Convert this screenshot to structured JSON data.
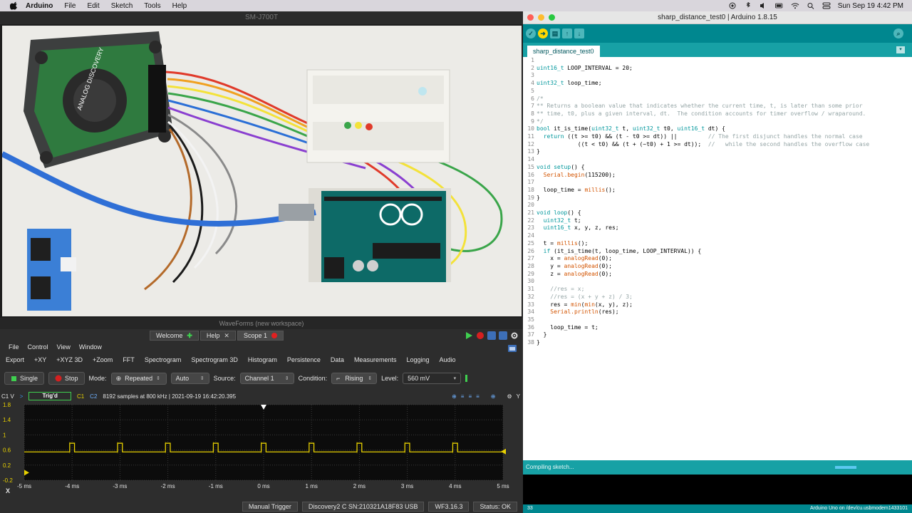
{
  "menubar": {
    "app_name": "Arduino",
    "items": [
      "File",
      "Edit",
      "Sketch",
      "Tools",
      "Help"
    ],
    "clock": "Sun Sep 19  4:42 PM"
  },
  "camera": {
    "title": "SM-J700T"
  },
  "waveforms": {
    "title": "WaveForms (new workspace)",
    "tabs": [
      "Welcome",
      "Help",
      "Scope 1"
    ],
    "menu": [
      "File",
      "Control",
      "View",
      "Window"
    ],
    "toolbar": [
      "Export",
      "+XY",
      "+XYZ 3D",
      "+Zoom",
      "FFT",
      "Spectrogram",
      "Spectrogram 3D",
      "Histogram",
      "Persistence",
      "Data",
      "Measurements",
      "Logging",
      "Audio"
    ],
    "controls": {
      "single": "Single",
      "stop": "Stop",
      "mode_label": "Mode:",
      "mode_value": "Repeated",
      "auto_value": "Auto",
      "source_label": "Source:",
      "source_value": "Channel 1",
      "condition_label": "Condition:",
      "condition_value": "Rising",
      "level_label": "Level:",
      "level_value": "560 mV"
    },
    "info": {
      "channel_unit": "C1 V",
      "trig_status": "Trig'd",
      "c1": "C1",
      "c2": "C2",
      "samples": "8192 samples at 800 kHz | 2021-09-19 16:42:20.395",
      "y": "Y"
    },
    "x_label": "X",
    "status": {
      "manual_trigger": "Manual Trigger",
      "device": "Discovery2 C SN:210321A18F83 USB",
      "version": "WF3.16.3",
      "status": "Status: OK"
    }
  },
  "chart_data": {
    "type": "line",
    "title": "",
    "xlabel": "",
    "ylabel": "C1 V",
    "xlim": [
      -5,
      5
    ],
    "ylim": [
      -0.2,
      1.8
    ],
    "x_ticks": [
      "-5 ms",
      "-4 ms",
      "-3 ms",
      "-2 ms",
      "-1 ms",
      "0 ms",
      "1 ms",
      "2 ms",
      "3 ms",
      "4 ms",
      "5 ms"
    ],
    "y_ticks": [
      "1.8",
      "1.4",
      "1",
      "0.6",
      "0.2",
      "-0.2"
    ],
    "series": [
      {
        "color": "#e8d100",
        "baseline": 0.55,
        "high": 0.78,
        "pulse_starts_ms": [
          -4.05,
          -3.05,
          -2.05,
          -1.05,
          -0.05,
          0.95,
          1.95,
          2.95,
          3.95
        ],
        "pulse_width_ms": 0.1
      }
    ],
    "trigger_level": 0.56,
    "trigger_time": 0,
    "grid": true
  },
  "ide": {
    "title": "sharp_distance_test0 | Arduino 1.8.15",
    "tab": "sharp_distance_test0",
    "console_message": "Compiling sketch...",
    "status_line": "33",
    "status_board": "Arduino Uno on /dev/cu.usbmodem1433101",
    "code_lines": [
      "",
      "uint16_t LOOP_INTERVAL = 20;",
      "",
      "uint32_t loop_time;",
      "",
      "/*",
      "** Returns a boolean value that indicates whether the current time, t, is later than some prior",
      "** time, t0, plus a given interval, dt.  The condition accounts for timer overflow / wraparound.",
      "*/",
      "bool it_is_time(uint32_t t, uint32_t t0, uint16_t dt) {",
      "  return ((t >= t0) && (t - t0 >= dt)) ||         // The first disjunct handles the normal case",
      "            ((t < t0) && (t + (~t0) + 1 >= dt));  //   while the second handles the overflow case",
      "}",
      "",
      "void setup() {",
      "  Serial.begin(115200);",
      "",
      "  loop_time = millis();",
      "}",
      "",
      "void loop() {",
      "  uint32_t t;",
      "  uint16_t x, y, z, res;",
      "",
      "  t = millis();",
      "  if (it_is_time(t, loop_time, LOOP_INTERVAL)) {",
      "    x = analogRead(0);",
      "    y = analogRead(0);",
      "    z = analogRead(0);",
      "",
      "    //res = x;",
      "    //res = (x + y + z) / 3;",
      "    res = min(min(x, y), z);",
      "    Serial.println(res);",
      "",
      "    loop_time = t;",
      "  }",
      "}"
    ]
  }
}
